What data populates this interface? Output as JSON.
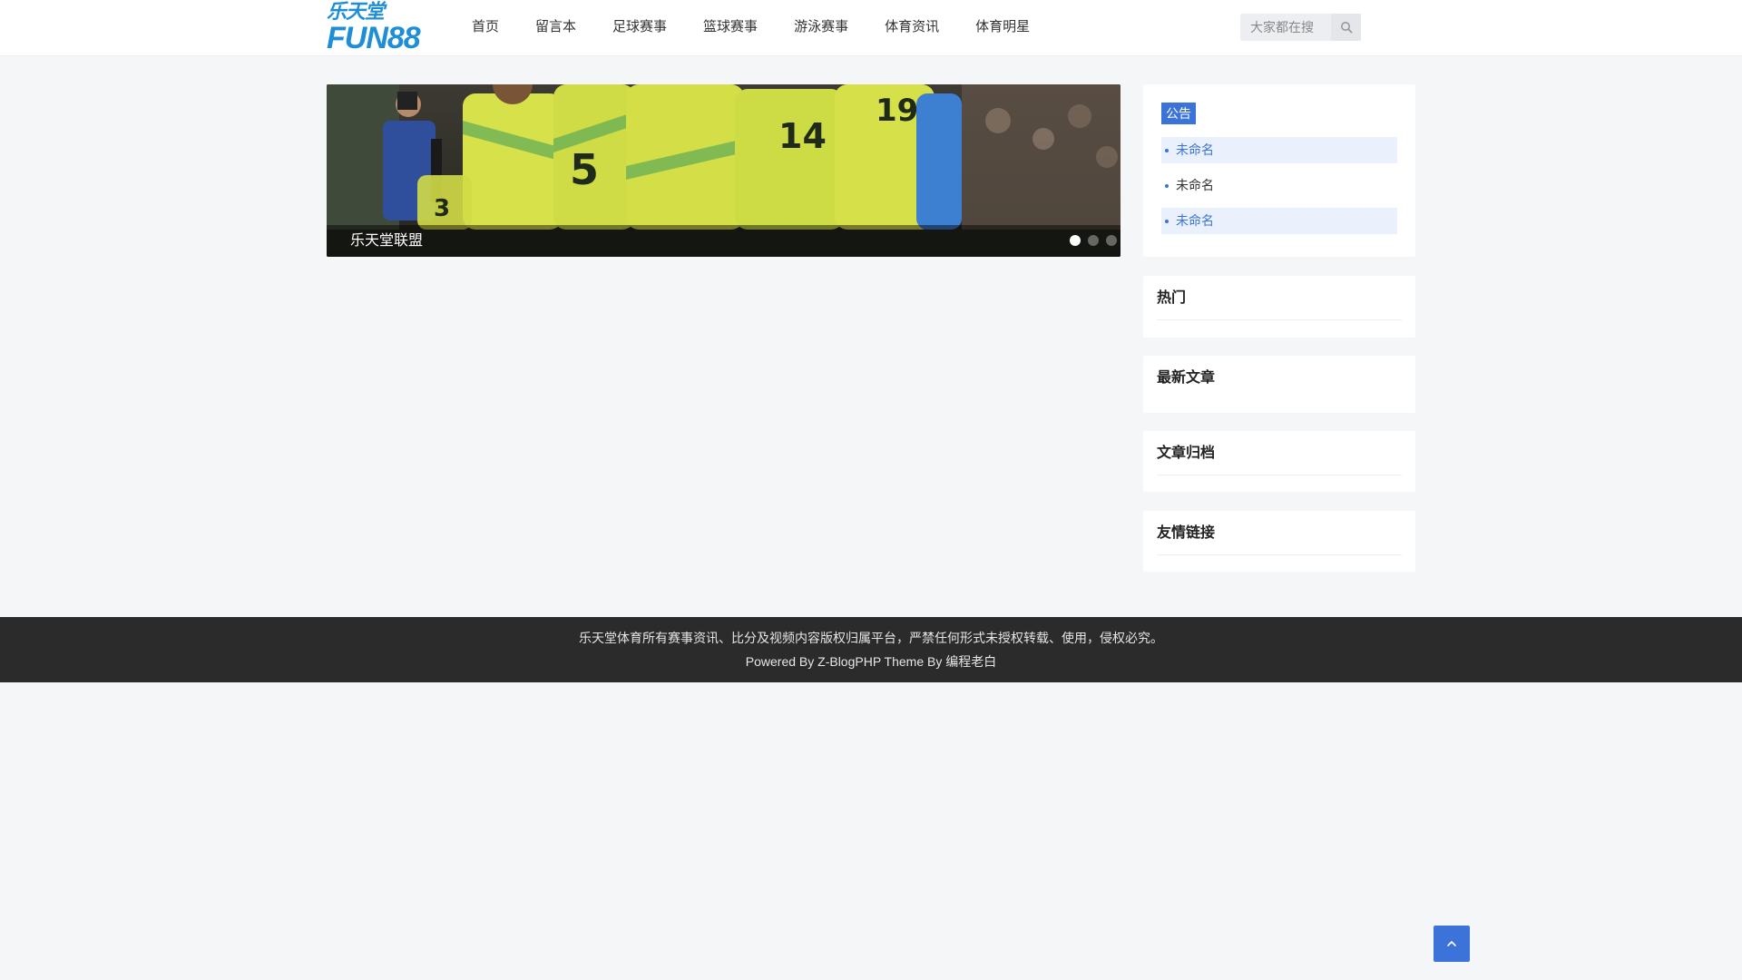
{
  "header": {
    "logo": {
      "top_text": "乐天堂",
      "bottom_text": "FUN88"
    },
    "nav": [
      {
        "label": "首页"
      },
      {
        "label": "留言本"
      },
      {
        "label": "足球赛事"
      },
      {
        "label": "篮球赛事"
      },
      {
        "label": "游泳赛事"
      },
      {
        "label": "体育资讯"
      },
      {
        "label": "体育明星"
      }
    ],
    "search": {
      "placeholder": "大家都在搜",
      "icon": "search-icon"
    }
  },
  "slider": {
    "caption": "乐天堂联盟",
    "slide_count": 3,
    "active_slide": 1
  },
  "sidebar": {
    "notice": {
      "title": "公告",
      "items": [
        {
          "label": "未命名",
          "highlighted": true
        },
        {
          "label": "未命名",
          "highlighted": false
        },
        {
          "label": "未命名",
          "highlighted": true
        }
      ]
    },
    "hot": {
      "title": "热门"
    },
    "latest": {
      "title": "最新文章"
    },
    "archive": {
      "title": "文章归档"
    },
    "links": {
      "title": "友情链接"
    }
  },
  "footer": {
    "copyright": "乐天堂体育所有赛事资讯、比分及视频内容版权归属平台，严禁任何形式未授权转载、使用，侵权必究。",
    "powered": "Powered By Z-BlogPHP Theme By 编程老白"
  },
  "back_to_top": {
    "icon": "chevron-up-icon"
  },
  "colors": {
    "brand": "#1e8fd6",
    "accent": "#3b73d9",
    "page_bg": "#f5f6f8",
    "footer_bg": "#2b2b2b"
  }
}
